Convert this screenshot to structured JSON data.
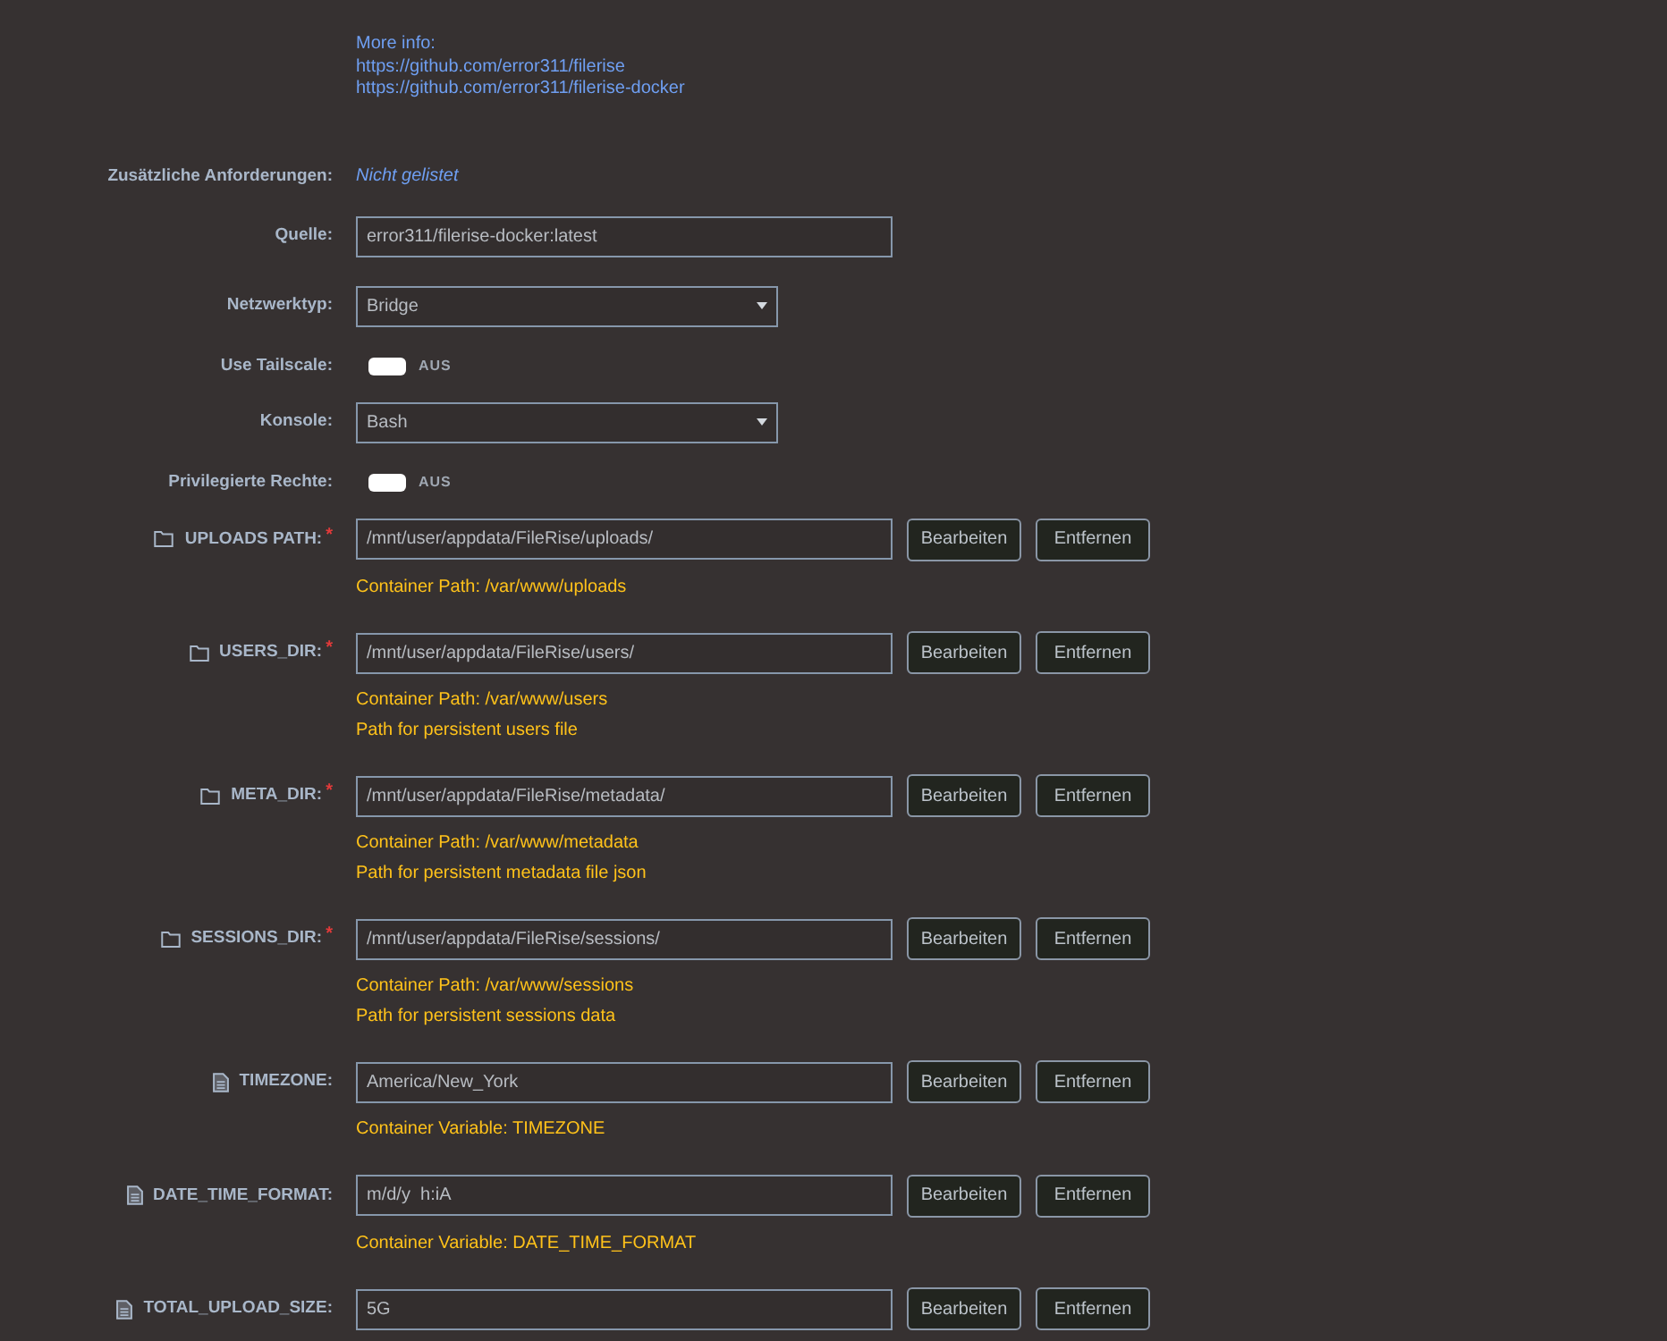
{
  "info": {
    "heading": "More info:",
    "links": [
      "https://github.com/error311/filerise",
      "https://github.com/error311/filerise-docker"
    ]
  },
  "settings": [
    {
      "kind": "note",
      "label": "Zusätzliche Anforderungen:",
      "value": "Nicht gelistet"
    },
    {
      "kind": "input",
      "label": "Quelle:",
      "value": "error311/filerise-docker:latest"
    },
    {
      "kind": "select",
      "label": "Netzwerktyp:",
      "value": "Bridge"
    },
    {
      "kind": "toggle",
      "label": "Use Tailscale:",
      "on": false,
      "state_label": "AUS"
    },
    {
      "kind": "select",
      "label": "Konsole:",
      "value": "Bash"
    },
    {
      "kind": "toggle",
      "label": "Privilegierte Rechte:",
      "on": false,
      "state_label": "AUS"
    }
  ],
  "mappings": [
    {
      "kind": "path",
      "label": "UPLOADS PATH:",
      "required_mark": "*",
      "value": "/mnt/user/appdata/FileRise/uploads/",
      "buttons": [
        "Bearbeiten",
        "Entfernen"
      ],
      "notes": [
        "Container Path: /var/www/uploads"
      ]
    },
    {
      "kind": "path",
      "label": "USERS_DIR:",
      "required_mark": "*",
      "value": "/mnt/user/appdata/FileRise/users/",
      "buttons": [
        "Bearbeiten",
        "Entfernen"
      ],
      "notes": [
        "Container Path: /var/www/users",
        "Path for persistent users file"
      ]
    },
    {
      "kind": "path",
      "label": "META_DIR:",
      "required_mark": "*",
      "value": "/mnt/user/appdata/FileRise/metadata/",
      "buttons": [
        "Bearbeiten",
        "Entfernen"
      ],
      "notes": [
        "Container Path: /var/www/metadata",
        "Path for persistent metadata file json"
      ]
    },
    {
      "kind": "path",
      "label": "SESSIONS_DIR:",
      "required_mark": "*",
      "value": "/mnt/user/appdata/FileRise/sessions/",
      "buttons": [
        "Bearbeiten",
        "Entfernen"
      ],
      "notes": [
        "Container Path: /var/www/sessions",
        "Path for persistent sessions data"
      ]
    },
    {
      "kind": "variable",
      "label": "TIMEZONE:",
      "value": "America/New_York",
      "buttons": [
        "Bearbeiten",
        "Entfernen"
      ],
      "notes": [
        "Container Variable: TIMEZONE"
      ]
    },
    {
      "kind": "variable",
      "label": "DATE_TIME_FORMAT:",
      "value": "m/d/y  h:iA",
      "buttons": [
        "Bearbeiten",
        "Entfernen"
      ],
      "notes": [
        "Container Variable: DATE_TIME_FORMAT"
      ]
    },
    {
      "kind": "variable",
      "label": "TOTAL_UPLOAD_SIZE:",
      "value": "5G",
      "buttons": [
        "Bearbeiten",
        "Entfernen"
      ]
    }
  ]
}
